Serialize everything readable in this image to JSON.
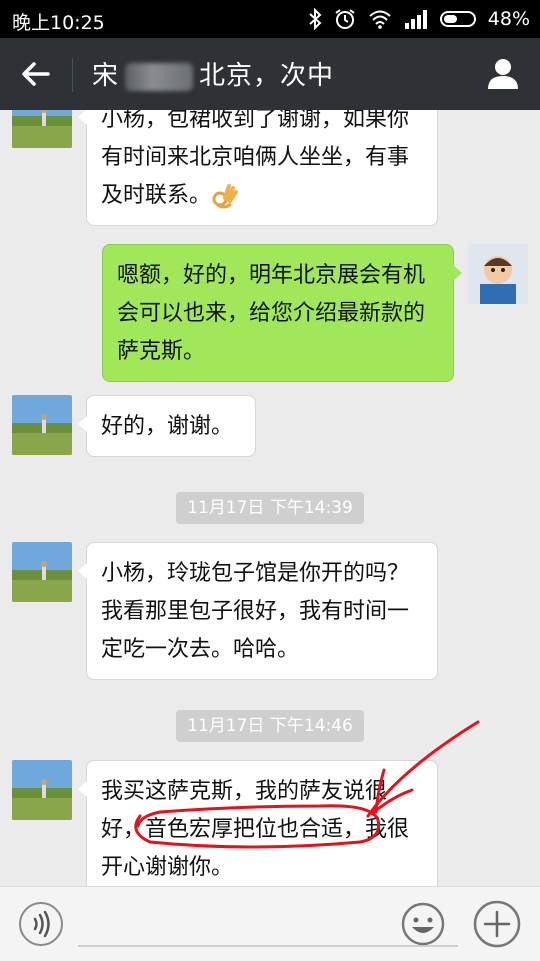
{
  "status": {
    "time": "晚上10:25",
    "battery": "48%",
    "battery_fill": 0.48
  },
  "header": {
    "title_prefix": "宋",
    "title_suffix": "北京，次中"
  },
  "messages": [
    {
      "side": "left",
      "text": "小杨，包裙收到了谢谢，如果你有时间来北京咱俩人坐坐，有事及时联系。",
      "emoji": "ok-hand-emoji"
    },
    {
      "side": "right",
      "text": "嗯额，好的，明年北京展会有机会可以也来，给您介绍最新款的萨克斯。"
    },
    {
      "side": "left",
      "text": "好的，谢谢。"
    },
    {
      "side": "left",
      "text": "小杨，玲珑包子馆是你开的吗？我看那里包子很好，我有时间一定吃一次去。哈哈。"
    },
    {
      "side": "left",
      "text": "我买这萨克斯，我的萨友说很好，音色宏厚把位也合适，我很开心谢谢你。"
    }
  ],
  "timestamps": [
    "11月17日 下午14:39",
    "11月17日 下午14:46"
  ],
  "colors": {
    "header_bg": "#2e3236",
    "chat_bg": "#ebebeb",
    "my_bubble": "#a0e75a",
    "annotation": "#e8101a"
  }
}
